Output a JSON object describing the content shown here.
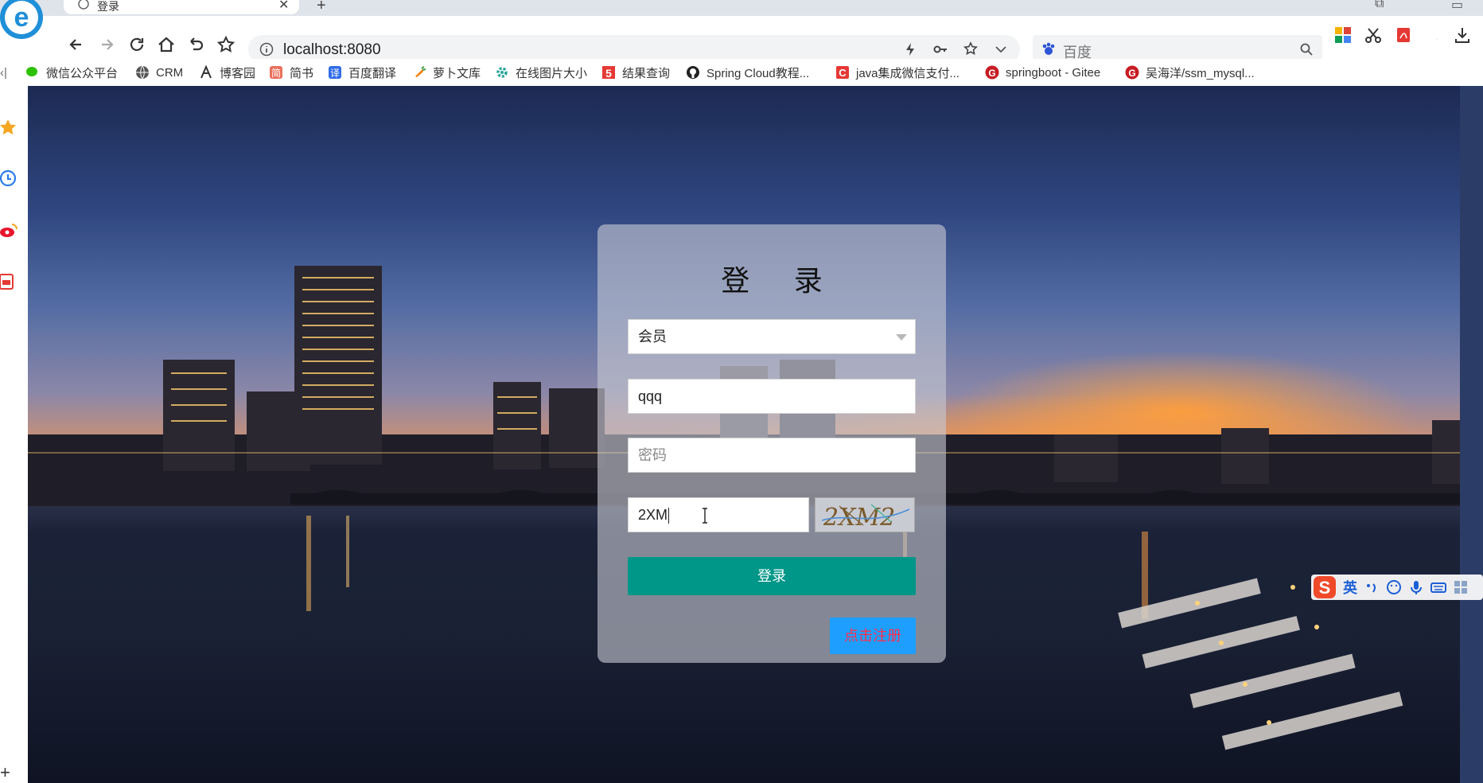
{
  "browser": {
    "tab_title": "登录",
    "url": "localhost:8080",
    "search_placeholder": "百度"
  },
  "bookmarks": [
    {
      "label": "微信公众平台",
      "icon": "wechat-icon"
    },
    {
      "label": "CRM",
      "icon": "globe-icon"
    },
    {
      "label": "博客园",
      "icon": "cnblogs-icon"
    },
    {
      "label": "简书",
      "icon": "jianshu-icon"
    },
    {
      "label": "百度翻译",
      "icon": "baidu-translate-icon"
    },
    {
      "label": "萝卜文库",
      "icon": "carrot-icon"
    },
    {
      "label": "在线图片大小",
      "icon": "gear-icon"
    },
    {
      "label": "结果查询",
      "icon": "five-icon"
    },
    {
      "label": "Spring Cloud教程...",
      "icon": "github-icon"
    },
    {
      "label": "java集成微信支付...",
      "icon": "csdn-icon"
    },
    {
      "label": "springboot - Gitee",
      "icon": "gitee-icon"
    },
    {
      "label": "吴海洋/ssm_mysql...",
      "icon": "gitee-icon"
    }
  ],
  "login": {
    "title": "登 录",
    "role_value": "会员",
    "username_value": "qqq",
    "password_placeholder": "密码",
    "captcha_value": "2XM",
    "captcha_image_text": "2XM2",
    "login_label": "登录",
    "register_label": "点击注册"
  },
  "ime": {
    "lang": "英"
  },
  "colors": {
    "login_button": "#009688",
    "register_button": "#1e9fff",
    "register_text": "#ff2d4b"
  }
}
